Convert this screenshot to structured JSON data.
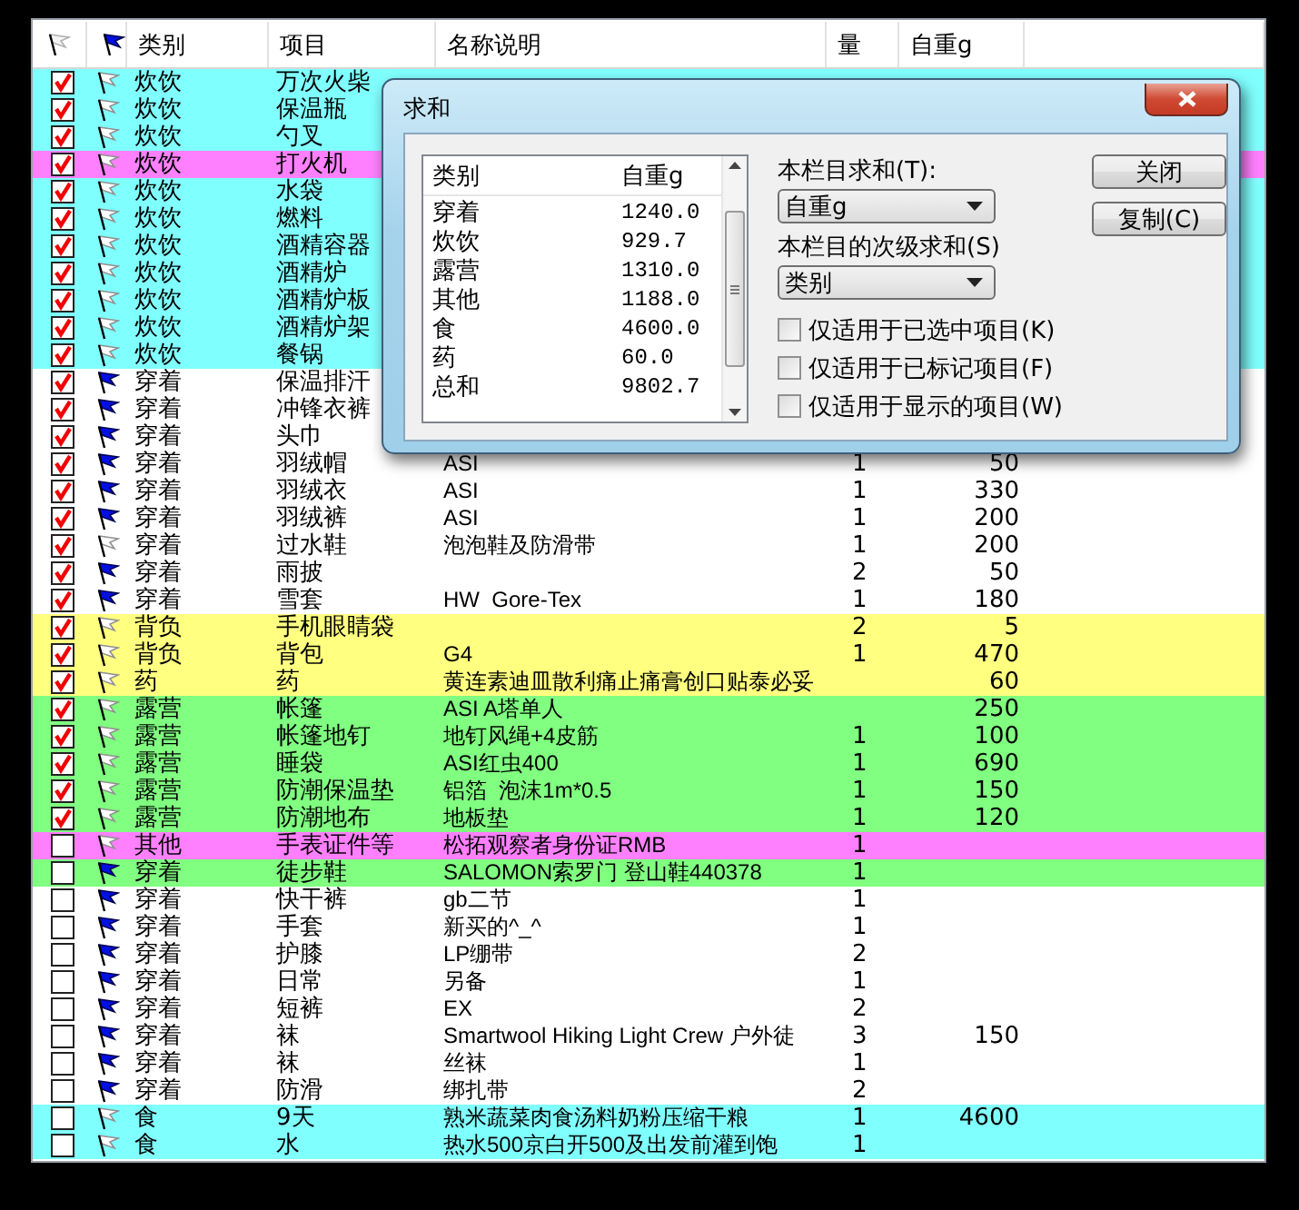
{
  "list": {
    "columns": [
      "类别",
      "项目",
      "名称说明",
      "量",
      "自重g"
    ],
    "rows": [
      {
        "checked": true,
        "flagged": false,
        "color": "#80ffff",
        "category": "炊饮",
        "item": "万次火柴"
      },
      {
        "checked": true,
        "flagged": false,
        "color": "#80ffff",
        "category": "炊饮",
        "item": "保温瓶"
      },
      {
        "checked": true,
        "flagged": false,
        "color": "#80ffff",
        "category": "炊饮",
        "item": "勺叉"
      },
      {
        "checked": true,
        "flagged": false,
        "color": "#ff80ff",
        "category": "炊饮",
        "item": "打火机"
      },
      {
        "checked": true,
        "flagged": false,
        "color": "#80ffff",
        "category": "炊饮",
        "item": "水袋"
      },
      {
        "checked": true,
        "flagged": false,
        "color": "#80ffff",
        "category": "炊饮",
        "item": "燃料"
      },
      {
        "checked": true,
        "flagged": false,
        "color": "#80ffff",
        "category": "炊饮",
        "item": "酒精容器"
      },
      {
        "checked": true,
        "flagged": false,
        "color": "#80ffff",
        "category": "炊饮",
        "item": "酒精炉"
      },
      {
        "checked": true,
        "flagged": false,
        "color": "#80ffff",
        "category": "炊饮",
        "item": "酒精炉板"
      },
      {
        "checked": true,
        "flagged": false,
        "color": "#80ffff",
        "category": "炊饮",
        "item": "酒精炉架"
      },
      {
        "checked": true,
        "flagged": false,
        "color": "#80ffff",
        "category": "炊饮",
        "item": "餐锅"
      },
      {
        "checked": true,
        "flagged": true,
        "color": "#ffffff",
        "category": "穿着",
        "item": "保温排汗"
      },
      {
        "checked": true,
        "flagged": true,
        "color": "#ffffff",
        "category": "穿着",
        "item": "冲锋衣裤"
      },
      {
        "checked": true,
        "flagged": true,
        "color": "#ffffff",
        "category": "穿着",
        "item": "头巾"
      },
      {
        "checked": true,
        "flagged": true,
        "color": "#ffffff",
        "category": "穿着",
        "item": "羽绒帽",
        "desc": "ASI",
        "qty": "1",
        "weight": "50"
      },
      {
        "checked": true,
        "flagged": true,
        "color": "#ffffff",
        "category": "穿着",
        "item": "羽绒衣",
        "desc": "ASI",
        "qty": "1",
        "weight": "330"
      },
      {
        "checked": true,
        "flagged": true,
        "color": "#ffffff",
        "category": "穿着",
        "item": "羽绒裤",
        "desc": "ASI",
        "qty": "1",
        "weight": "200"
      },
      {
        "checked": true,
        "flagged": false,
        "color": "#ffffff",
        "category": "穿着",
        "item": "过水鞋",
        "desc": "泡泡鞋及防滑带",
        "qty": "1",
        "weight": "200"
      },
      {
        "checked": true,
        "flagged": true,
        "color": "#ffffff",
        "category": "穿着",
        "item": "雨披",
        "qty": "2",
        "weight": "50"
      },
      {
        "checked": true,
        "flagged": true,
        "color": "#ffffff",
        "category": "穿着",
        "item": "雪套",
        "desc": "HW  Gore-Tex",
        "qty": "1",
        "weight": "180"
      },
      {
        "checked": true,
        "flagged": false,
        "color": "#ffff80",
        "category": "背负",
        "item": "手机眼睛袋",
        "qty": "2",
        "weight": "5"
      },
      {
        "checked": true,
        "flagged": false,
        "color": "#ffff80",
        "category": "背负",
        "item": "背包",
        "desc": "G4",
        "qty": "1",
        "weight": "470"
      },
      {
        "checked": true,
        "flagged": false,
        "color": "#ffff80",
        "category": "药",
        "item": "药",
        "desc": "黄连素迪皿散利痛止痛膏创口贴泰必妥",
        "weight": "60"
      },
      {
        "checked": true,
        "flagged": false,
        "color": "#80ff80",
        "category": "露营",
        "item": "帐篷",
        "desc": "ASI A塔单人",
        "weight": "250"
      },
      {
        "checked": true,
        "flagged": false,
        "color": "#80ff80",
        "category": "露营",
        "item": "帐篷地钉",
        "desc": "地钉风绳+4皮筋",
        "qty": "1",
        "weight": "100"
      },
      {
        "checked": true,
        "flagged": false,
        "color": "#80ff80",
        "category": "露营",
        "item": "睡袋",
        "desc": "ASI红虫400",
        "qty": "1",
        "weight": "690"
      },
      {
        "checked": true,
        "flagged": false,
        "color": "#80ff80",
        "category": "露营",
        "item": "防潮保温垫",
        "desc": "铝箔  泡沫1m*0.5",
        "qty": "1",
        "weight": "150"
      },
      {
        "checked": true,
        "flagged": false,
        "color": "#80ff80",
        "category": "露营",
        "item": "防潮地布",
        "desc": "地板垫",
        "qty": "1",
        "weight": "120"
      },
      {
        "checked": false,
        "flagged": false,
        "color": "#ff80ff",
        "category": "其他",
        "item": "手表证件等",
        "desc": "松拓观察者身份证RMB",
        "qty": "1"
      },
      {
        "checked": false,
        "flagged": true,
        "color": "#80ff80",
        "category": "穿着",
        "item": "徒步鞋",
        "desc": "SALOMON索罗门 登山鞋440378",
        "qty": "1"
      },
      {
        "checked": false,
        "flagged": true,
        "color": "#ffffff",
        "category": "穿着",
        "item": "快干裤",
        "desc": "gb二节",
        "qty": "1"
      },
      {
        "checked": false,
        "flagged": true,
        "color": "#ffffff",
        "category": "穿着",
        "item": "手套",
        "desc": "新买的^_^",
        "qty": "1"
      },
      {
        "checked": false,
        "flagged": true,
        "color": "#ffffff",
        "category": "穿着",
        "item": "护膝",
        "desc": "LP绷带",
        "qty": "2"
      },
      {
        "checked": false,
        "flagged": true,
        "color": "#ffffff",
        "category": "穿着",
        "item": "日常",
        "desc": "另备",
        "qty": "1"
      },
      {
        "checked": false,
        "flagged": true,
        "color": "#ffffff",
        "category": "穿着",
        "item": "短裤",
        "desc": "EX",
        "qty": "2"
      },
      {
        "checked": false,
        "flagged": true,
        "color": "#ffffff",
        "category": "穿着",
        "item": "袜",
        "desc": "Smartwool Hiking Light Crew 户外徒",
        "qty": "3",
        "weight": "150"
      },
      {
        "checked": false,
        "flagged": true,
        "color": "#ffffff",
        "category": "穿着",
        "item": "袜",
        "desc": "丝袜",
        "qty": "1"
      },
      {
        "checked": false,
        "flagged": true,
        "color": "#ffffff",
        "category": "穿着",
        "item": "防滑",
        "desc": "绑扎带",
        "qty": "2"
      },
      {
        "checked": false,
        "flagged": false,
        "color": "#80ffff",
        "category": "食",
        "item": "9天",
        "desc": "熟米蔬菜肉食汤料奶粉压缩干粮",
        "qty": "1",
        "weight": "4600"
      },
      {
        "checked": false,
        "flagged": false,
        "color": "#80ffff",
        "category": "食",
        "item": "水",
        "desc": "热水500京白开500及出发前灌到饱",
        "qty": "1"
      }
    ]
  },
  "dialog": {
    "title": "求和",
    "table": {
      "columns": [
        "类别",
        "自重g"
      ],
      "rows": [
        [
          "穿着",
          "1240.0"
        ],
        [
          "炊饮",
          "929.7"
        ],
        [
          "露营",
          "1310.0"
        ],
        [
          "其他",
          "1188.0"
        ],
        [
          "食",
          "4600.0"
        ],
        [
          "药",
          "60.0"
        ],
        [
          "总和",
          "9802.7"
        ]
      ]
    },
    "sum_label": "本栏目求和(T):",
    "sum_value": "自重g",
    "sub_label": "本栏目的次级求和(S)",
    "sub_value": "类别",
    "options": [
      {
        "label": "仅适用于已选中项目(K)",
        "checked": false
      },
      {
        "label": "仅适用于已标记项目(F)",
        "checked": false
      },
      {
        "label": "仅适用于显示的项目(W)",
        "checked": false
      }
    ],
    "buttons": [
      "关闭",
      "复制(C)"
    ]
  }
}
